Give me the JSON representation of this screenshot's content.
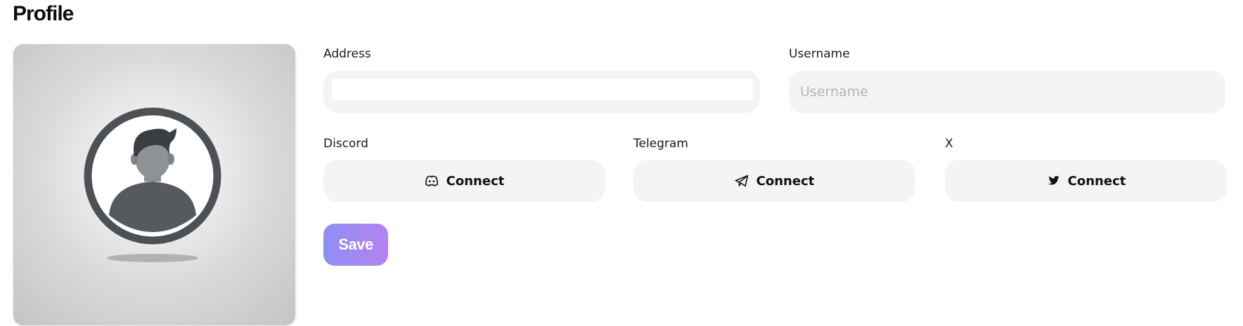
{
  "page": {
    "title": "Profile"
  },
  "avatar": {
    "icon": "user-avatar-placeholder"
  },
  "fields": {
    "address": {
      "label": "Address",
      "value": ""
    },
    "username": {
      "label": "Username",
      "placeholder": "Username",
      "value": ""
    }
  },
  "socials": {
    "discord": {
      "label": "Discord",
      "button": "Connect",
      "icon": "discord-icon"
    },
    "telegram": {
      "label": "Telegram",
      "button": "Connect",
      "icon": "telegram-icon"
    },
    "x": {
      "label": "X",
      "button": "Connect",
      "icon": "twitter-bird-icon"
    }
  },
  "actions": {
    "save_label": "Save"
  },
  "colors": {
    "field_background": "#f4f4f4",
    "save_gradient_start": "#8e8ff5",
    "save_gradient_end": "#b383f0"
  }
}
